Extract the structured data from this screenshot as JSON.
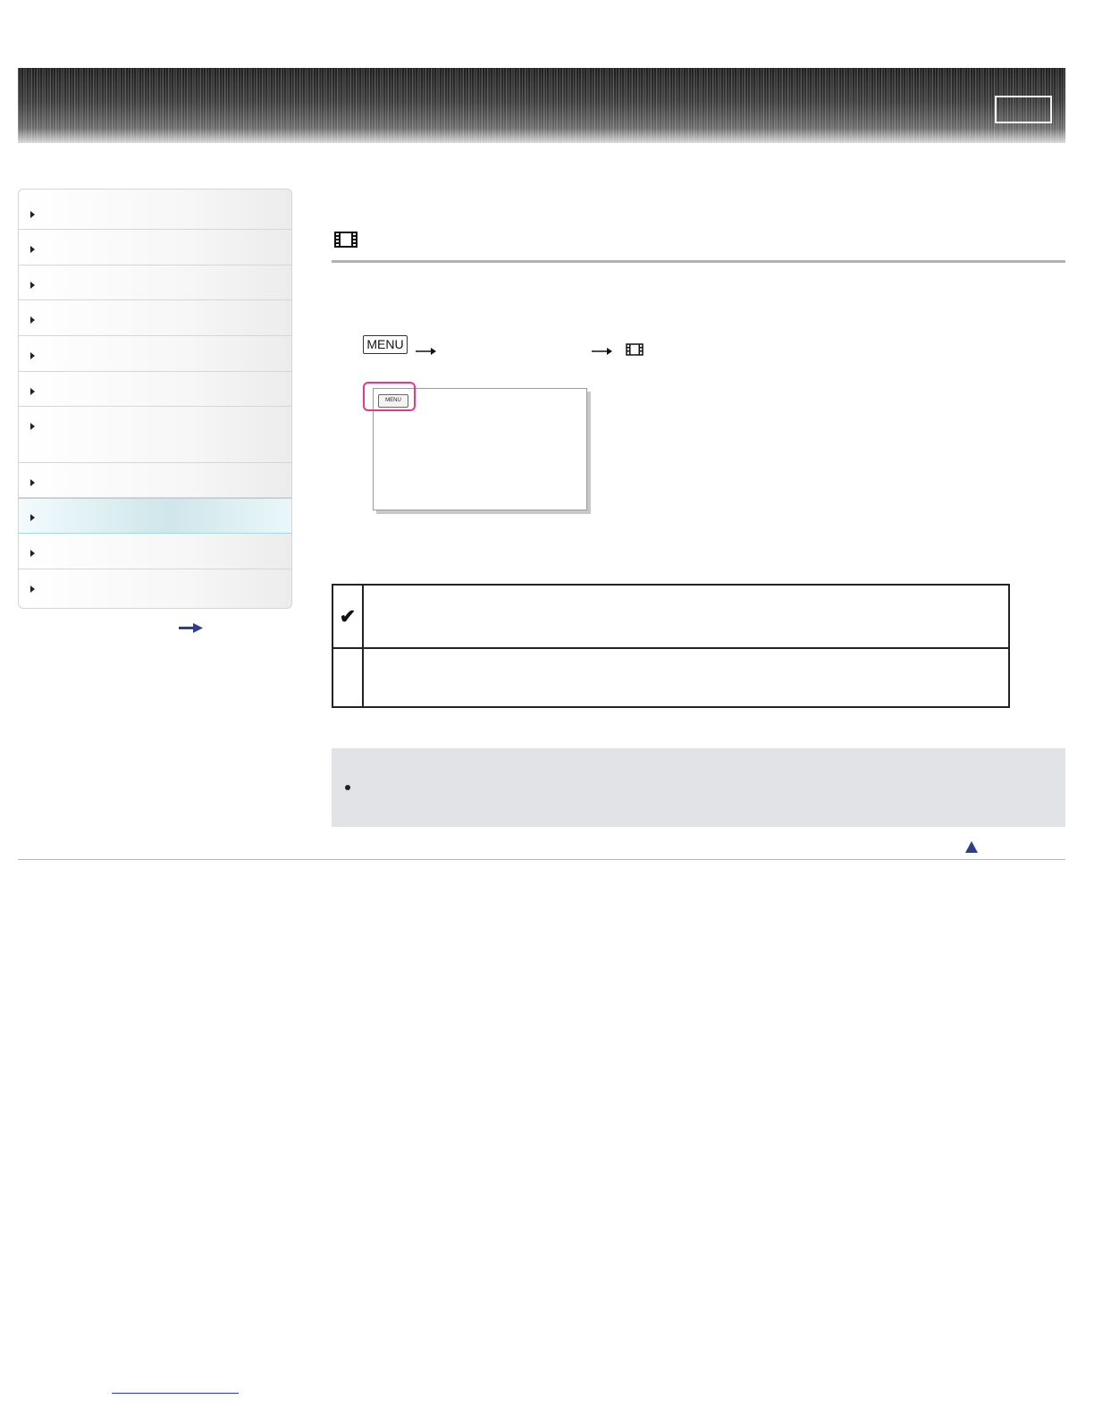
{
  "header": {
    "button_label": ""
  },
  "sidebar": {
    "items": [
      {
        "label": "",
        "active": false
      },
      {
        "label": "",
        "active": false
      },
      {
        "label": "",
        "active": false
      },
      {
        "label": "",
        "active": false
      },
      {
        "label": "",
        "active": false
      },
      {
        "label": "",
        "active": false
      },
      {
        "label": "",
        "active": false
      },
      {
        "label": "",
        "active": false
      },
      {
        "label": "",
        "active": true
      },
      {
        "label": "",
        "active": false
      },
      {
        "label": "",
        "active": false
      }
    ],
    "more_link_icon": "right-arrow-icon"
  },
  "main": {
    "section_title_icon": "film-strip-icon",
    "menu_key_label": "MENU",
    "step_arrow_icon": "right-arrow-icon",
    "screen_menu_key_label": "MENU",
    "options": [
      {
        "selected": true,
        "mark": "✔",
        "description": ""
      },
      {
        "selected": false,
        "mark": "",
        "description": ""
      }
    ],
    "note": {
      "text": ""
    },
    "page_top_icon": "up-triangle-icon"
  },
  "colors": {
    "active_nav": "#cfe6ea",
    "highlight_border": "#e4388d",
    "note_background": "#e1e3e7",
    "link": "#2b3bd1",
    "page_top_arrow": "#2c3e8c"
  }
}
